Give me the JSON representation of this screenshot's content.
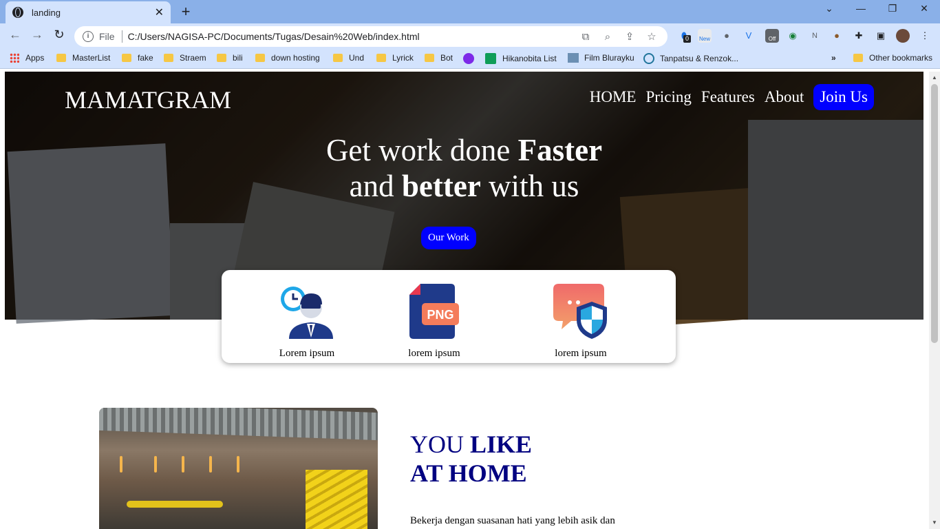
{
  "browser": {
    "tab_title": "landing",
    "url_scheme_label": "File",
    "url": "C:/Users/NAGISA-PC/Documents/Tugas/Desain%20Web/index.html",
    "ext_badge_count": "0",
    "ext_new_label": "New",
    "ext_off_label": "Off",
    "bookmarks": [
      "Apps",
      "MasterList",
      "fake",
      "Straem",
      "bili",
      "down hosting",
      "Und",
      "Lyrick",
      "Bot",
      "Hikanobita List",
      "Film Blurayku",
      "Tanpatsu & Renzok...",
      "Other bookmarks"
    ]
  },
  "page": {
    "brand": "MAMATGRAM",
    "nav": [
      "HOME",
      "Pricing",
      "Features",
      "About"
    ],
    "join_label": "Join Us",
    "headline_line1_a": "Get work done ",
    "headline_line1_b": "Faster",
    "headline_line2_a": "and ",
    "headline_line2_b": "better",
    "headline_line2_c": " with us",
    "cta_label": "Our Work",
    "features": [
      "Lorem ipsum",
      "lorem ipsum",
      "lorem ipsum"
    ],
    "png_label": "PNG",
    "section_title_a": "YOU ",
    "section_title_b": "LIKE",
    "section_title_c": "AT HOME",
    "section_text": "Bekerja dengan suasanan hati yang lebih asik dan"
  },
  "colors": {
    "accent": "#0000ff",
    "title": "#000080"
  }
}
